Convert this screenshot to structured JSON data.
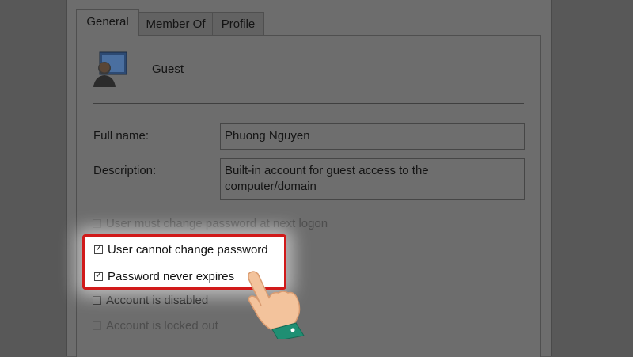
{
  "tabs": [
    {
      "label": "General",
      "active": true
    },
    {
      "label": "Member Of",
      "active": false
    },
    {
      "label": "Profile",
      "active": false
    }
  ],
  "user": {
    "name": "Guest",
    "icon": "user-account-icon"
  },
  "fields": {
    "full_name_label": "Full name:",
    "full_name_value": "Phuong Nguyen",
    "description_label": "Description:",
    "description_value": "Built-in account for guest access to the computer/domain"
  },
  "checkboxes": [
    {
      "label": "User must change password at next logon",
      "checked": false,
      "enabled": false
    },
    {
      "label": "User cannot change password",
      "checked": true,
      "enabled": true
    },
    {
      "label": "Password never expires",
      "checked": true,
      "enabled": true
    },
    {
      "label": "Account is disabled",
      "checked": false,
      "enabled": true
    },
    {
      "label": "Account is locked out",
      "checked": false,
      "enabled": false
    }
  ],
  "colors": {
    "highlight_border": "#d11a1a",
    "hand_cuff": "#1f8f73",
    "hand_skin": "#f3c39c"
  },
  "icons": {
    "pointer": "pointing-hand-icon",
    "check": "checkmark-icon"
  }
}
